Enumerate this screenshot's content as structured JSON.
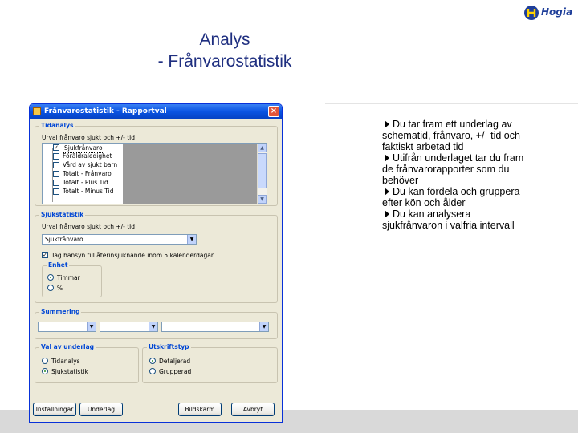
{
  "slide": {
    "title_line1": "Analys",
    "title_line2": "- Frånvarostatistik",
    "logo": "Hogia",
    "bullets": [
      "Du tar fram ett underlag av schematid, frånvaro, +/- tid och faktiskt arbetad tid",
      "Utifrån underlaget tar du fram de frånvarorapporter som du behöver",
      "Du kan fördela och gruppera efter kön och ålder",
      "Du kan analysera sjukfrånvaron i valfria intervall"
    ]
  },
  "dialog": {
    "title": "Frånvarostatistik - Rapportval",
    "tidanalys": {
      "label": "Tidanalys",
      "prompt": "Urval frånvaro sjukt och +/- tid",
      "items": [
        {
          "label": "Sjukfrånvaro",
          "checked": true
        },
        {
          "label": "Föräldraledighet",
          "checked": false
        },
        {
          "label": "Vård av sjukt barn",
          "checked": false
        },
        {
          "label": "Totalt - Frånvaro",
          "checked": false
        },
        {
          "label": "Totalt - Plus Tid",
          "checked": false
        },
        {
          "label": "Totalt - Minus Tid",
          "checked": false
        }
      ]
    },
    "sjukstatistik": {
      "label": "Sjukstatistik",
      "prompt": "Urval frånvaro sjukt och +/- tid",
      "selected": "Sjukfrånvaro",
      "checkbox_label": "Tag hänsyn till återinsjuknande inom 5 kalenderdagar",
      "enhet": {
        "label": "Enhet",
        "options": [
          "Timmar",
          "%"
        ],
        "selected": "Timmar"
      }
    },
    "summering": {
      "label": "Summering",
      "values": [
        "",
        "",
        ""
      ]
    },
    "val_av_underlag": {
      "label": "Val av underlag",
      "options": [
        "Tidanalys",
        "Sjukstatistik"
      ],
      "selected": "Sjukstatistik"
    },
    "utskriftstyp": {
      "label": "Utskriftstyp",
      "options": [
        "Detaljerad",
        "Grupperad"
      ],
      "selected": "Detaljerad"
    },
    "buttons": {
      "settings": "Inställningar",
      "preview": "Underlag",
      "screen": "Bildskärm",
      "cancel": "Avbryt"
    }
  }
}
